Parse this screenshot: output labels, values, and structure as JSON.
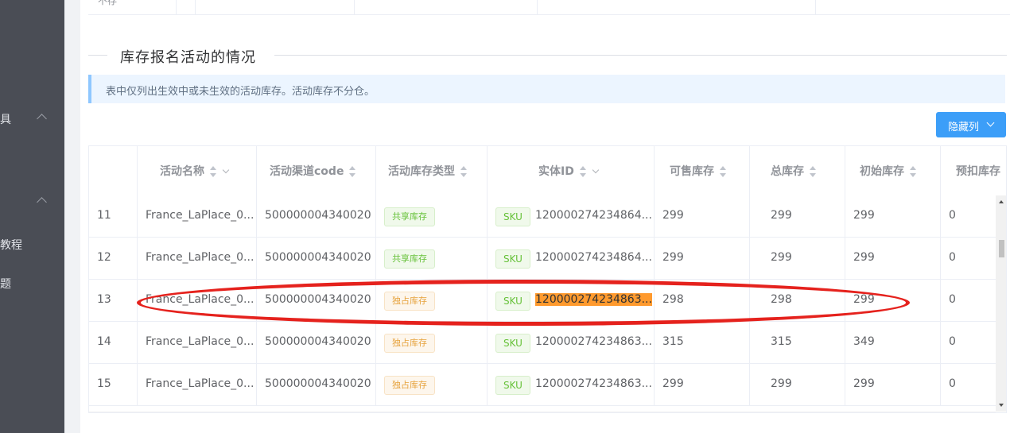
{
  "sidebar": {
    "items": [
      {
        "label": "具"
      },
      {
        "label": "教程"
      },
      {
        "label": "题"
      }
    ]
  },
  "top_table": {
    "row_label": "不存"
  },
  "section": {
    "title": "库存报名活动的情况"
  },
  "alert": {
    "text": "表中仅列出生效中或未生效的活动库存。活动库存不分仓。"
  },
  "toolbar": {
    "hide_columns_label": "隐藏列"
  },
  "table": {
    "columns": [
      "活动名称",
      "活动渠道code",
      "活动库存类型",
      "实体ID",
      "可售库存",
      "总库存",
      "初始库存",
      "预扣库存"
    ],
    "rows": [
      {
        "index": "11",
        "name": "France_LaPlace_0...",
        "channel": "500000004340020",
        "type": "共享库存",
        "type_kind": "shared",
        "entity_tag": "SKU",
        "entity_id": "120000274234864...",
        "sellable": "299",
        "total": "299",
        "initial": "299",
        "withheld": "0"
      },
      {
        "index": "12",
        "name": "France_LaPlace_0...",
        "channel": "500000004340020",
        "type": "共享库存",
        "type_kind": "shared",
        "entity_tag": "SKU",
        "entity_id": "120000274234864...",
        "sellable": "299",
        "total": "299",
        "initial": "299",
        "withheld": "0"
      },
      {
        "index": "13",
        "name": "France_LaPlace_0...",
        "channel": "500000004340020",
        "type": "独占库存",
        "type_kind": "exclusive",
        "entity_tag": "SKU",
        "entity_id": "120000274234863...",
        "sellable": "298",
        "total": "298",
        "initial": "299",
        "withheld": "0"
      },
      {
        "index": "14",
        "name": "France_LaPlace_0...",
        "channel": "500000004340020",
        "type": "独占库存",
        "type_kind": "exclusive",
        "entity_tag": "SKU",
        "entity_id": "120000274234863...",
        "sellable": "315",
        "total": "315",
        "initial": "349",
        "withheld": "0"
      },
      {
        "index": "15",
        "name": "France_LaPlace_0...",
        "channel": "500000004340020",
        "type": "独占库存",
        "type_kind": "exclusive",
        "entity_tag": "SKU",
        "entity_id": "120000274234863...",
        "sellable": "299",
        "total": "299",
        "initial": "299",
        "withheld": "0"
      }
    ]
  },
  "colors": {
    "primary": "#409eff",
    "shared_tag": "#67c23a",
    "exclusive_tag": "#e6a23c",
    "highlight": "#ff9a2e",
    "annotation": "#e5221d"
  }
}
